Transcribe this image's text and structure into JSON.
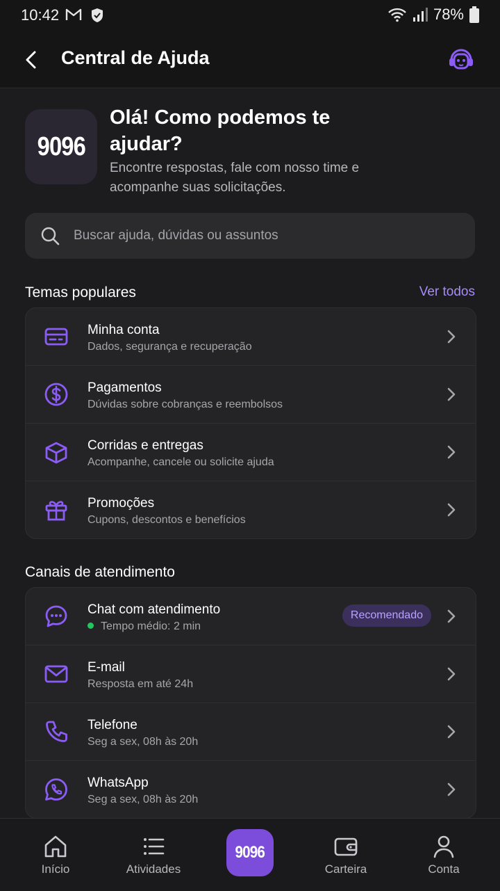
{
  "status_bar": {
    "time": "10:42",
    "battery": "78%",
    "icons": [
      "gmail-icon",
      "shield-icon",
      "wifi-icon",
      "signal-icon",
      "battery-icon"
    ]
  },
  "header": {
    "title": "Central de Ajuda",
    "back_icon": "back-arrow-icon",
    "support_icon": "support-headset-icon"
  },
  "hero": {
    "logo_text": "9096",
    "title": "Olá! Como podemos te ajudar?",
    "subtitle": "Encontre respostas, fale com nosso time e acompanhe suas solicitações."
  },
  "search": {
    "placeholder": "Buscar ajuda, dúvidas ou assuntos",
    "value": ""
  },
  "popular": {
    "title": "Temas populares",
    "see_all": "Ver todos",
    "items": [
      {
        "title": "Minha conta",
        "subtitle": "Dados, segurança e recuperação",
        "icon": "card-icon"
      },
      {
        "title": "Pagamentos",
        "subtitle": "Dúvidas sobre cobranças e reembolsos",
        "icon": "dollar-icon"
      },
      {
        "title": "Corridas e entregas",
        "subtitle": "Acompanhe, cancele ou solicite ajuda",
        "icon": "box-icon"
      },
      {
        "title": "Promoções",
        "subtitle": "Cupons, descontos e benefícios",
        "icon": "gift-icon"
      }
    ]
  },
  "channels": {
    "title": "Canais de atendimento",
    "items": [
      {
        "title": "Chat com atendimento",
        "subtitle": "Tempo médio: 2 min",
        "badge": "Recomendado",
        "icon": "chat-icon"
      },
      {
        "title": "E-mail",
        "subtitle": "Resposta em até 24h",
        "icon": "mail-icon"
      },
      {
        "title": "Telefone",
        "subtitle": "Seg a sex, 08h às 20h",
        "icon": "phone-icon"
      },
      {
        "title": "WhatsApp",
        "subtitle": "Seg a sex, 08h às 20h",
        "icon": "whatsapp-icon"
      }
    ]
  },
  "bottom_nav": {
    "items": [
      {
        "label": "Início",
        "icon": "home-icon"
      },
      {
        "label": "Atividades",
        "icon": "list-icon"
      },
      {
        "label": "9096",
        "icon": "brand-logo"
      },
      {
        "label": "Carteira",
        "icon": "wallet-icon"
      },
      {
        "label": "Conta",
        "icon": "user-icon"
      }
    ]
  },
  "colors": {
    "accent": "#8b5cf6",
    "background": "#1c1c1e",
    "card": "#242426",
    "online": "#22c55e"
  }
}
